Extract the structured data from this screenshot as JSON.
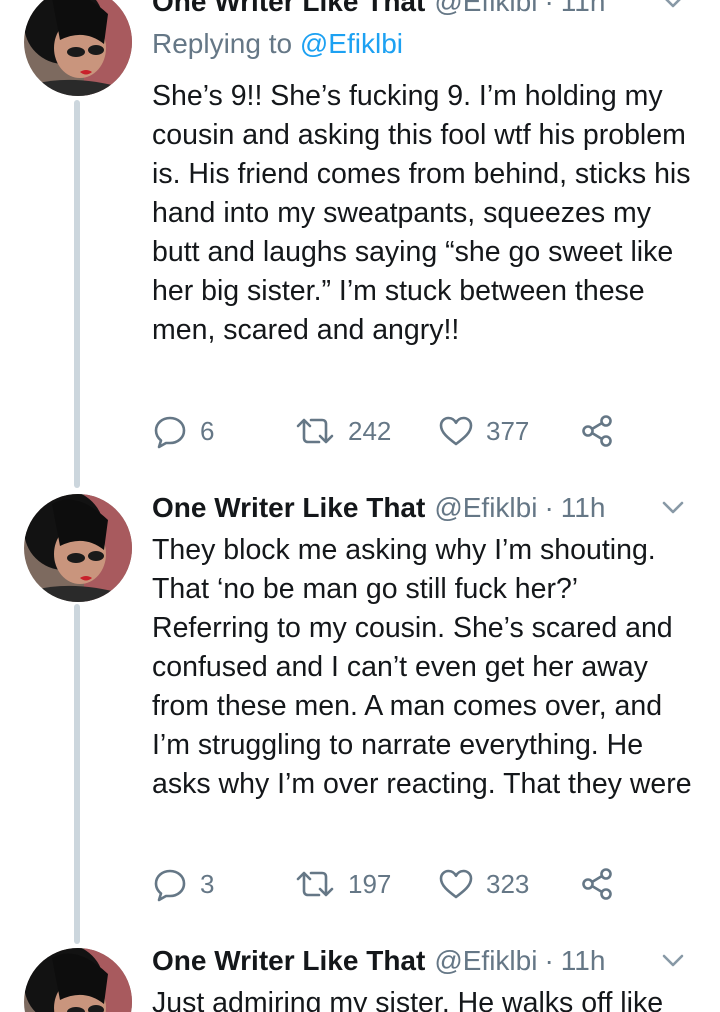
{
  "colors": {
    "text": "#14171a",
    "secondary": "#657786",
    "link": "#1da1f2",
    "thread_line": "#ccd6dd"
  },
  "tweets": [
    {
      "author": "One Writer Like That",
      "handle": "@Efiklbi",
      "separator": "·",
      "time": "11h",
      "replying_prefix": "Replying to",
      "replying_to": "@Efiklbi",
      "text": "She’s 9!! She’s fucking 9. I’m holding my cousin and asking this fool wtf his problem is. His friend comes from behind, sticks his hand into my sweatpants, squeezes my butt and laughs saying “she go sweet like her big sister.” I’m stuck between these men, scared and angry!!",
      "replies": "6",
      "retweets": "242",
      "likes": "377"
    },
    {
      "author": "One Writer Like That",
      "handle": "@Efiklbi",
      "separator": "·",
      "time": "11h",
      "text": "They block me asking why I’m shouting. That ‘no be man go still fuck her?’ Referring to my cousin. She’s scared and confused and I can’t even get her away from these men. A man comes over, and I’m struggling to narrate everything. He asks why I’m over reacting. That they were",
      "replies": "3",
      "retweets": "197",
      "likes": "323"
    },
    {
      "author": "One Writer Like That",
      "handle": "@Efiklbi",
      "separator": "·",
      "time": "11h",
      "text": "Just admiring my sister. He walks off like"
    }
  ],
  "icons": {
    "reply": "reply-icon",
    "retweet": "retweet-icon",
    "like": "heart-icon",
    "share": "share-icon",
    "menu": "chevron-down-icon"
  }
}
